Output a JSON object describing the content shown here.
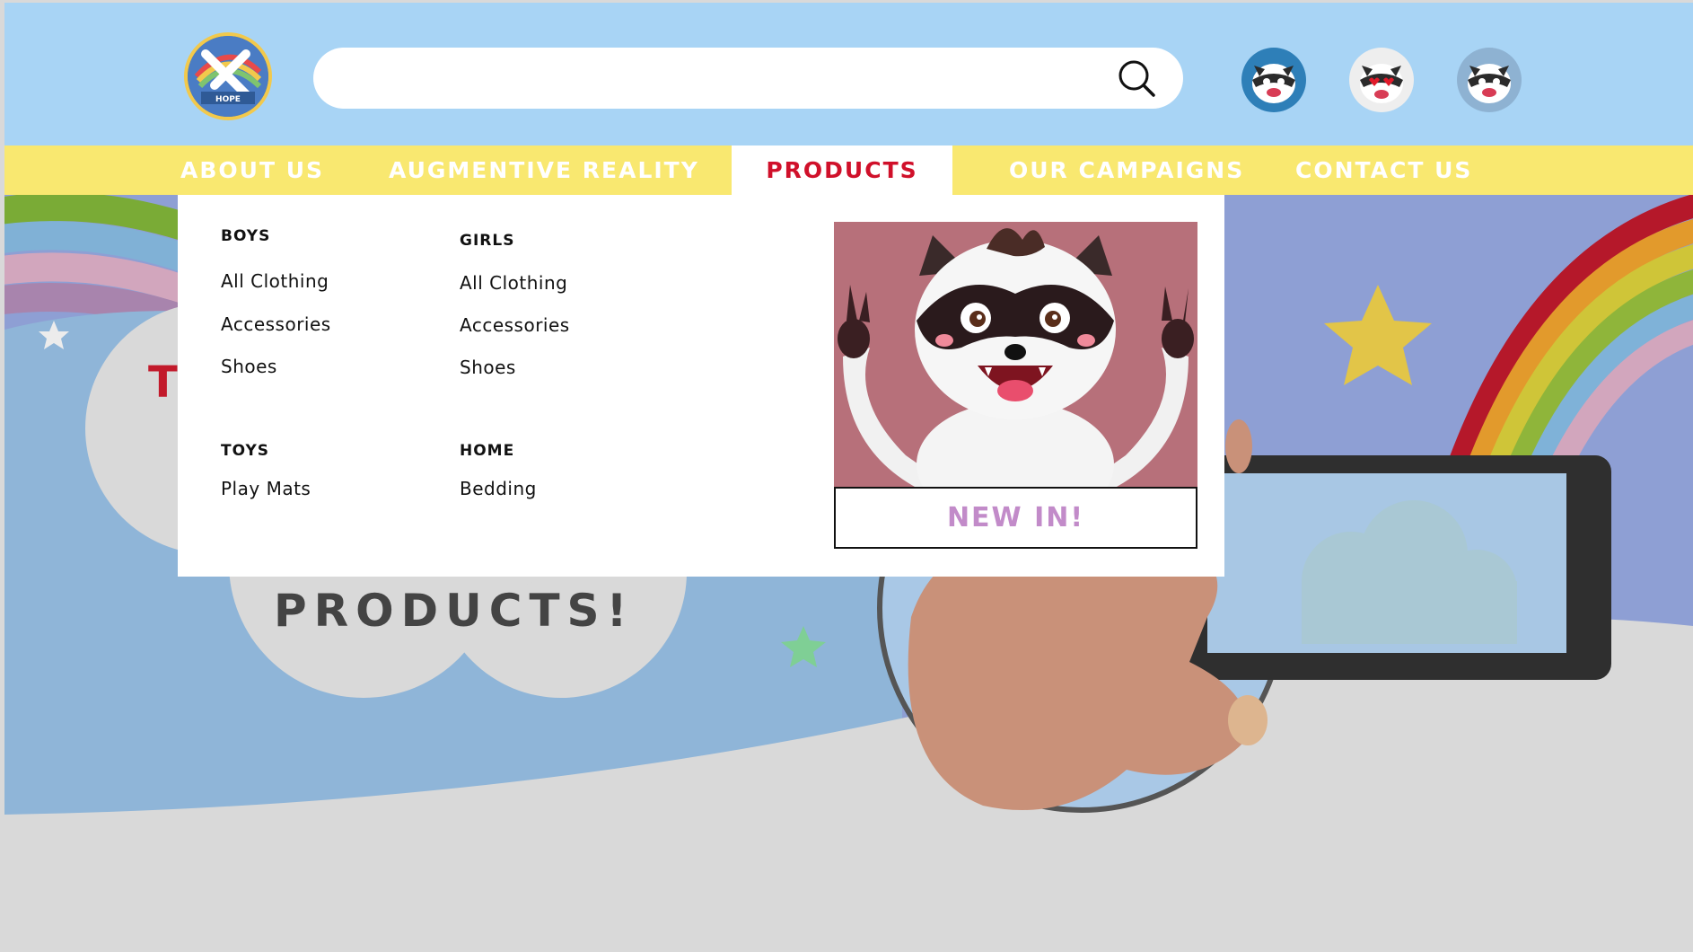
{
  "colors": {
    "header_bg": "#a8d4f5",
    "nav_bg": "#f9e870",
    "nav_text": "#ffffff",
    "nav_active_text": "#d0102a",
    "new_in_text": "#c28bc9"
  },
  "logo": {
    "icon": "hope-dove-logo",
    "text": "HOPE"
  },
  "search": {
    "placeholder": "",
    "icon": "search-icon"
  },
  "avatars": [
    {
      "icon": "raccoon-avatar-icon"
    },
    {
      "icon": "raccoon-heart-eyes-avatar-icon"
    },
    {
      "icon": "raccoon-avatar-icon"
    }
  ],
  "nav": {
    "items": [
      {
        "label": "ABOUT US"
      },
      {
        "label": "AUGMENTIVE REALITY"
      },
      {
        "label": "PRODUCTS",
        "active": true
      },
      {
        "label": "OUR CAMPAIGNS"
      },
      {
        "label": "CONTACT US"
      }
    ]
  },
  "dropdown": {
    "boys": {
      "title": "BOYS",
      "links": [
        "All Clothing",
        "Accessories",
        "Shoes"
      ]
    },
    "girls": {
      "title": "GIRLS",
      "links": [
        "All Clothing",
        "Accessories",
        "Shoes"
      ]
    },
    "toys": {
      "title": "TOYS",
      "links": [
        "Play Mats"
      ]
    },
    "home": {
      "title": "HOME",
      "links": [
        "Bedding"
      ]
    },
    "promo": {
      "image": "raccoon-mascot-image",
      "button_label": "NEW IN!"
    }
  },
  "hero": {
    "title_partial": "T",
    "title_rest": "PRODUCTS!"
  }
}
